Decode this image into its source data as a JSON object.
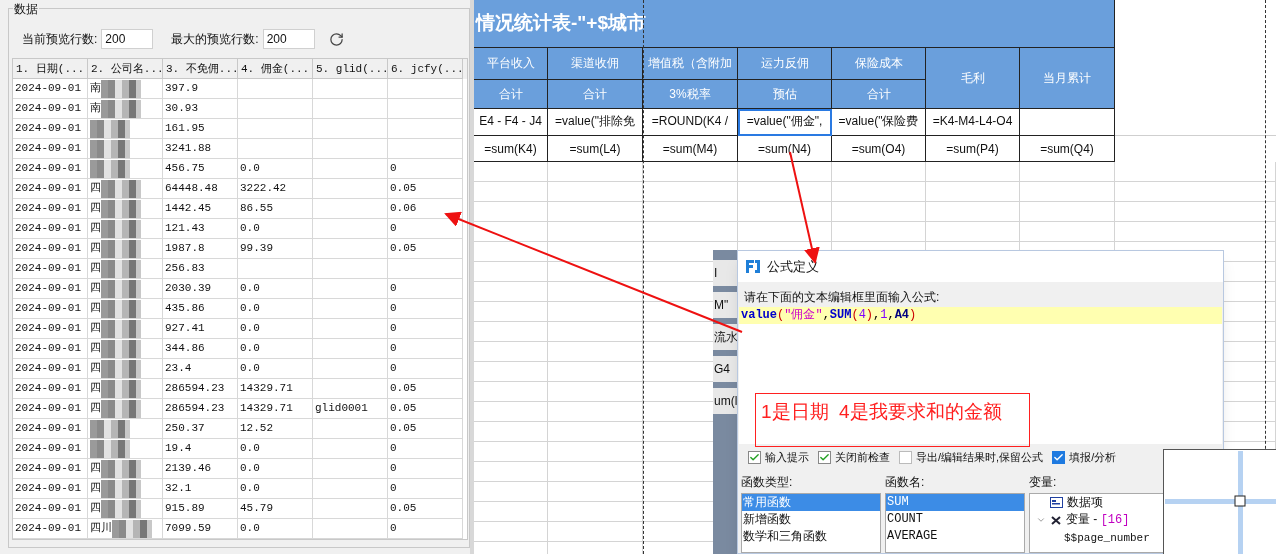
{
  "data_panel": {
    "title": "数据",
    "current_rows_label": "当前预览行数:",
    "current_rows": "200",
    "max_rows_label": "最大的预览行数:",
    "max_rows": "200",
    "columns": [
      "1. 日期(...",
      "2. 公司名...",
      "3. 不免佣...",
      "4. 佣金(...",
      "5. glid(...",
      "6. jcfy(..."
    ],
    "rows": [
      {
        "date": "2024-09-01",
        "company": "南",
        "amount": "397.9"
      },
      {
        "date": "2024-09-01",
        "company": "南",
        "amount": "30.93"
      },
      {
        "date": "2024-09-01",
        "amount": "161.95"
      },
      {
        "date": "2024-09-01",
        "amount": "3241.88"
      },
      {
        "date": "2024-09-01",
        "amount": "456.75",
        "commission": "0.0",
        "jcfy": "0"
      },
      {
        "date": "2024-09-01",
        "company": "四",
        "amount": "64448.48",
        "commission": "3222.42",
        "jcfy": "0.05"
      },
      {
        "date": "2024-09-01",
        "company": "四",
        "amount": "1442.45",
        "commission": "86.55",
        "jcfy": "0.06"
      },
      {
        "date": "2024-09-01",
        "company": "四",
        "amount": "121.43",
        "commission": "0.0",
        "jcfy": "0"
      },
      {
        "date": "2024-09-01",
        "company": "四",
        "amount": "1987.8",
        "commission": "99.39",
        "jcfy": "0.05"
      },
      {
        "date": "2024-09-01",
        "company": "四",
        "amount": "256.83"
      },
      {
        "date": "2024-09-01",
        "company": "四",
        "amount": "2030.39",
        "commission": "0.0",
        "jcfy": "0"
      },
      {
        "date": "2024-09-01",
        "company": "四",
        "amount": "435.86",
        "commission": "0.0",
        "jcfy": "0"
      },
      {
        "date": "2024-09-01",
        "company": "四",
        "amount": "927.41",
        "commission": "0.0",
        "jcfy": "0"
      },
      {
        "date": "2024-09-01",
        "company": "四",
        "amount": "344.86",
        "commission": "0.0",
        "jcfy": "0"
      },
      {
        "date": "2024-09-01",
        "company": "四",
        "amount": "23.4",
        "commission": "0.0",
        "jcfy": "0"
      },
      {
        "date": "2024-09-01",
        "company": "四",
        "amount": "286594.23",
        "commission": "14329.71",
        "jcfy": "0.05"
      },
      {
        "date": "2024-09-01",
        "company": "四",
        "amount": "286594.23",
        "commission": "14329.71",
        "glid": "glid0001",
        "jcfy": "0.05"
      },
      {
        "date": "2024-09-01",
        "amount": "250.37",
        "commission": "12.52",
        "jcfy": "0.05"
      },
      {
        "date": "2024-09-01",
        "amount": "19.4",
        "commission": "0.0",
        "jcfy": "0"
      },
      {
        "date": "2024-09-01",
        "company": "四",
        "amount": "2139.46",
        "commission": "0.0",
        "jcfy": "0"
      },
      {
        "date": "2024-09-01",
        "company": "四",
        "amount": "32.1",
        "commission": "0.0",
        "jcfy": "0"
      },
      {
        "date": "2024-09-01",
        "company": "四",
        "amount": "915.89",
        "commission": "45.79",
        "jcfy": "0.05"
      },
      {
        "date": "2024-09-01",
        "company": "四川",
        "amount": "7099.59",
        "commission": "0.0",
        "jcfy": "0"
      }
    ]
  },
  "sheet": {
    "title": "情况统计表-\"+$城市",
    "headers": [
      {
        "label": "平台收入",
        "sub": "合计"
      },
      {
        "label": "渠道收佣",
        "sub": "合计"
      },
      {
        "label": "增值税（含附加",
        "sub": "3%税率"
      },
      {
        "label": "运力反佣",
        "sub": "预估"
      },
      {
        "label": "保险成本",
        "sub": "合计"
      },
      {
        "label": "毛利"
      },
      {
        "label": "当月累计"
      }
    ],
    "formulas": [
      {
        "text": "E4 - F4 - J4",
        "selected": false
      },
      {
        "text": "=value(\"排除免",
        "selected": false
      },
      {
        "text": "=ROUND(K4 /",
        "selected": false
      },
      {
        "text": "=value(\"佣金\",",
        "selected": true
      },
      {
        "text": "=value(\"保险费",
        "selected": false
      },
      {
        "text": "=K4-M4-L4-O4",
        "selected": false
      },
      {
        "selected": false
      }
    ],
    "sums": [
      "=sum(K4)",
      "=sum(L4)",
      "=sum(M4)",
      "=sum(N4)",
      "=sum(O4)",
      "=sum(P4)",
      "=sum(Q4)"
    ]
  },
  "background_window": {
    "labels": [
      "I",
      "M\"",
      "流水",
      "G4",
      "um(l"
    ]
  },
  "dialog": {
    "title": "公式定义",
    "prompt": "请在下面的文本编辑框里面输入公式:",
    "formula": [
      {
        "kind": "function",
        "text": "value"
      },
      {
        "kind": "paren",
        "text": "("
      },
      {
        "kind": "string",
        "text": "\"佣金\""
      },
      {
        "kind": "punct",
        "text": ","
      },
      {
        "kind": "function",
        "text": "SUM"
      },
      {
        "kind": "paren",
        "text": "("
      },
      {
        "kind": "number",
        "text": "4"
      },
      {
        "kind": "paren",
        "text": ")"
      },
      {
        "kind": "punct",
        "text": ","
      },
      {
        "kind": "number",
        "text": "1"
      },
      {
        "kind": "punct",
        "text": ","
      },
      {
        "kind": "ref",
        "text": "A4"
      },
      {
        "kind": "paren",
        "text": ")"
      }
    ],
    "annotation": "1是日期  4是我要求和的金额",
    "options": [
      {
        "label": "输入提示",
        "checked": true,
        "kind": "tick"
      },
      {
        "label": "关闭前检查",
        "checked": true,
        "kind": "tick"
      },
      {
        "label": "导出/编辑结果时,保留公式",
        "checked": false,
        "kind": "tick"
      },
      {
        "label": "填报/分析",
        "checked": true,
        "kind": "filled"
      }
    ],
    "function_types_label": "函数类型:",
    "function_types": [
      {
        "label": "常用函数",
        "selected": true
      },
      {
        "label": "新增函数",
        "selected": false
      },
      {
        "label": "数学和三角函数",
        "selected": false
      }
    ],
    "function_names_label": "函数名:",
    "function_names": [
      {
        "label": "SUM",
        "selected": true
      },
      {
        "label": "COUNT",
        "selected": false
      },
      {
        "label": "AVERAGE",
        "selected": false
      }
    ],
    "variables_label": "变量:",
    "variables": [
      {
        "kind": "data",
        "label": "数据项"
      },
      {
        "kind": "variable",
        "label": "变量 - ",
        "count": "[16]",
        "expanded": true,
        "children": [
          {
            "label": "$$page_number"
          }
        ]
      }
    ]
  }
}
